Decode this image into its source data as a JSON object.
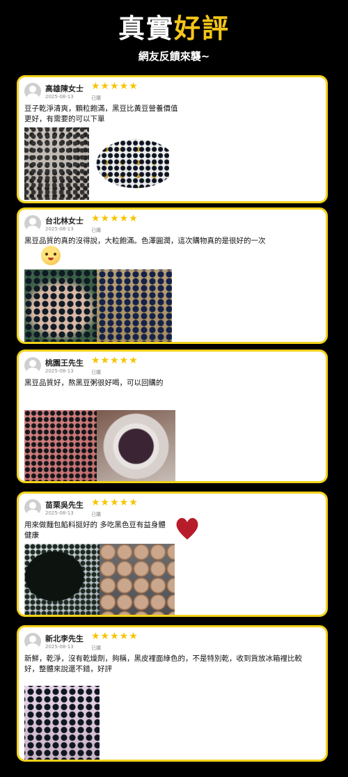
{
  "header": {
    "title_part1": "真實",
    "title_part2": "好評",
    "subtitle": "網友反饋來襲~"
  },
  "colors": {
    "accent": "#f5c518",
    "card_border": "#f2d21a",
    "star": "#f6c400",
    "heart": "#b71c2b"
  },
  "reviews": [
    {
      "name": "高雄陳女士",
      "stars": "★★★★★",
      "date": "2025-08-13",
      "bought": "已購",
      "text": "豆子乾淨清爽，顆粒飽滿，黑豆比黃豆營養價值更好，有需要的可以下單",
      "photos": [
        "beans-pile",
        "bowl-beans"
      ]
    },
    {
      "name": "台北林女士",
      "stars": "★★★★★",
      "date": "2025-08-13",
      "bought": "已購",
      "text": "黑豆品質的真的沒得說，大粒飽滿。色澤圓潤，這次購物真的是很好的一次",
      "photos": [
        "hand-beans",
        "table-beans"
      ]
    },
    {
      "name": "桃園王先生",
      "stars": "★★★★★",
      "date": "2025-08-13",
      "bought": "已購",
      "text": "黑豆品質好，熬黑豆粥很好喝，可以回購的",
      "photos": [
        "pink-beans",
        "porridge"
      ]
    },
    {
      "name": "苗栗吳先生",
      "stars": "★★★★★",
      "date": "2025-08-13",
      "bought": "已購",
      "text": "用來做麵包餡料挺好的 多吃黑色豆有益身體健康",
      "photos": [
        "bag-beans",
        "bread"
      ]
    },
    {
      "name": "新北李先生",
      "stars": "★★★★★",
      "date": "2025-08-13",
      "bought": "已購",
      "text": "新鮮，乾淨，沒有乾燥劑，夠稱，黑皮裡面綠色的，不是特別乾，收到貨放冰箱裡比較好，整體來說還不錯，好評",
      "photos": [
        "tray-beans"
      ]
    }
  ]
}
